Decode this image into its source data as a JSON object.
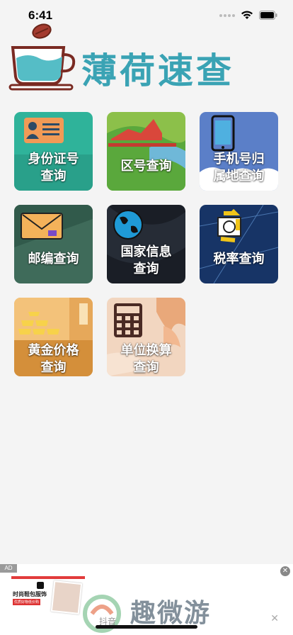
{
  "status": {
    "time": "6:41",
    "icons": [
      "signal-dots-icon",
      "wifi-icon",
      "battery-icon"
    ]
  },
  "header": {
    "title": "薄荷速查",
    "logo": "tea-cup-logo-icon",
    "title_color": "#3aa3b4"
  },
  "tiles": [
    {
      "id": "id-card",
      "lines": [
        "身份证号",
        "查询"
      ],
      "bg": "#2fb39a",
      "icon": "id-card-icon"
    },
    {
      "id": "area-code",
      "lines": [
        "区号查询"
      ],
      "bg": "#8cc04a",
      "icon": "mountain-flag-icon"
    },
    {
      "id": "phone-location",
      "lines": [
        "手机号归",
        "属地查询"
      ],
      "bg": "#5b7fc8",
      "icon": "phone-icon"
    },
    {
      "id": "postcode",
      "lines": [
        "邮编查询"
      ],
      "bg": "#3f6b5a",
      "icon": "envelope-icon"
    },
    {
      "id": "country-info",
      "lines": [
        "国家信息",
        "查询"
      ],
      "bg": "#1a1e26",
      "icon": "globe-icon"
    },
    {
      "id": "tax-rate",
      "lines": [
        "税率查询"
      ],
      "bg": "#173466",
      "icon": "recycle-money-icon"
    },
    {
      "id": "gold-price",
      "lines": [
        "黄金价格",
        "查询"
      ],
      "bg": "#e0a14a",
      "icon": "gold-bars-icon"
    },
    {
      "id": "unit-convert",
      "lines": [
        "单位换算",
        "查询"
      ],
      "bg": "#f2d6c0",
      "icon": "calculator-icon"
    }
  ],
  "ad": {
    "tag": "AD",
    "close": "✕",
    "thumb_title": "时尚鞋包服饰",
    "thumb_sub": "优质好物低价购",
    "watermark": "趣微游",
    "small_text": "抖音"
  }
}
